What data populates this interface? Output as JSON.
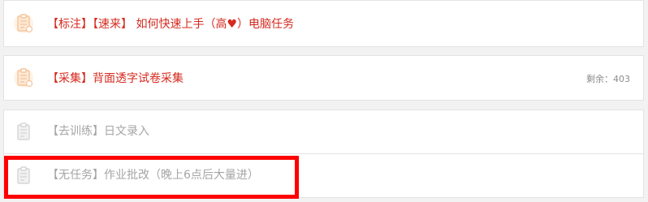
{
  "tasks": [
    {
      "label": "【标注】【速来】 如何快速上手（高♥）电脑任务",
      "icon": "clipboard-icon",
      "state": "active"
    },
    {
      "label": "【采集】背面透字试卷采集",
      "icon": "clipboard-icon",
      "state": "active",
      "remaining_label": "剩余：",
      "remaining_count": "403"
    },
    {
      "label": "【去训练】日文录入",
      "icon": "clipboard-icon",
      "state": "inactive"
    },
    {
      "label": "【无任务】作业批改（晚上6点后大量进）",
      "icon": "clipboard-icon",
      "state": "inactive"
    }
  ],
  "colors": {
    "active_text": "#d52a1f",
    "inactive_text": "#a5a5a5",
    "active_icon": "#f6c49a",
    "inactive_icon": "#d5d5d5",
    "highlight_border": "#ff0000"
  }
}
